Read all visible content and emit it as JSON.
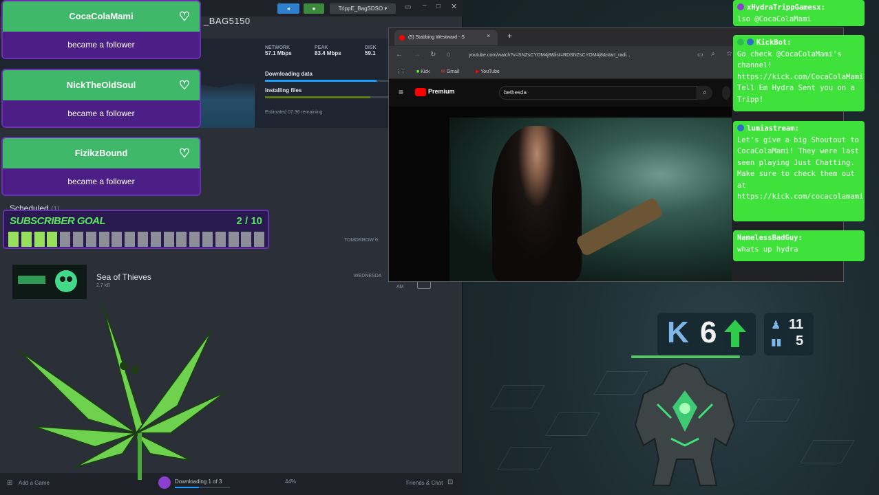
{
  "steam": {
    "username": "_BAG5150",
    "titlebar_user": "TrippE_BagSDSO",
    "stats": [
      {
        "label": "NETWORK",
        "value": "57.1 Mbps"
      },
      {
        "label": "PEAK",
        "value": "83.4 Mbps"
      },
      {
        "label": "DISK",
        "value": "59.1"
      }
    ],
    "tasks": [
      {
        "label": "Downloading data",
        "progress": 0.9
      },
      {
        "label": "Installing files",
        "progress": 0.85
      }
    ],
    "estimate": "Estimated 07:36 remaining",
    "scheduled_label": "Scheduled",
    "scheduled_count": "(1)",
    "upcoming": [
      {
        "title": "Sea of Thieves",
        "size": "2.7 kB",
        "when": "WEDNESDA"
      }
    ],
    "tomorrow_label": "TOMORROW 6:",
    "misc_value": "AM",
    "bottom": {
      "add_game": "Add a Game",
      "downloading": "Downloading 1 of 3",
      "percent": "44%",
      "friends": "Friends & Chat"
    }
  },
  "alerts": [
    {
      "name": "CocaColaMami",
      "action": "became a follower"
    },
    {
      "name": "NickTheOldSoul",
      "action": "became a follower"
    },
    {
      "name": "FizikzBound",
      "action": "became a follower"
    }
  ],
  "subscriber_goal": {
    "title": "SUBSCRIBER GOAL",
    "count": "2 / 10",
    "progress": 0.2
  },
  "browser": {
    "tab_title": "(5) Stabbing Westward - S",
    "url": "youtube.com/watch?v=SNZsCYOM4j8&list=RDSNZsCYOM4j8&start_radi...",
    "bookmarks": [
      "Kick",
      "Gmail",
      "YouTube"
    ],
    "youtube_logo": "Premium",
    "search_value": "bethesda"
  },
  "chat": [
    {
      "user": "xHydraTrippGamesx:",
      "message": "lso @CocaColaMami"
    },
    {
      "user": "KickBot:",
      "message": "Go check @CocaColaMami's channel! https://kick.com/CocaColaMami Tell Em Hydra Sent you on a Tripp!"
    },
    {
      "user": "lumiastream:",
      "message": "Let's give a big Shoutout to CocaColaMami! They were last seen playing Just Chatting. Make sure to check them out at https://kick.com/cocacolamami"
    },
    {
      "user": "NamelessBadGuy:",
      "message": "whats up hydra"
    }
  ],
  "stats_overlay": {
    "kick_letter": "K",
    "kick_count": "6",
    "rank_top": "11",
    "rank_bottom": "5"
  },
  "colors": {
    "alert_green": "#3fb86a",
    "alert_purple": "#4b1f86",
    "chat_green": "#3ee23a",
    "goal_green": "#59e85e"
  }
}
